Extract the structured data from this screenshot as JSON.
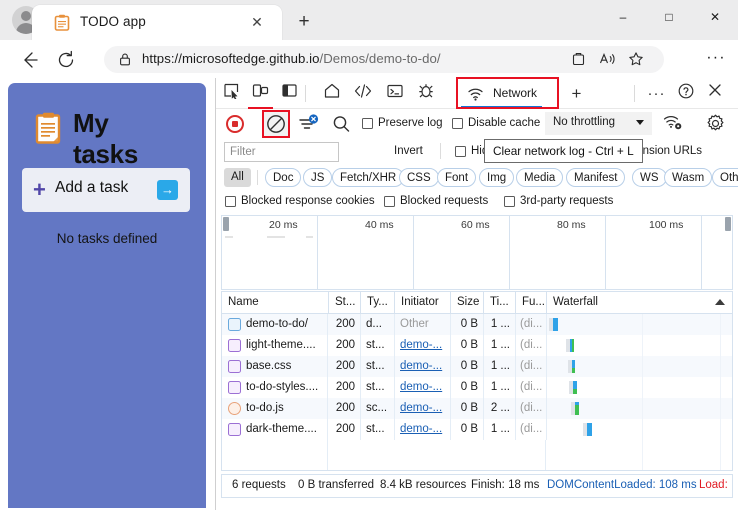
{
  "browser": {
    "tab": {
      "title": "TODO app",
      "favicon": "clipboard-icon",
      "close": "✕"
    },
    "new_tab": "+",
    "window_controls": {
      "minimize": "–",
      "maximize": "□",
      "close": "✕"
    },
    "nav": {
      "back": "←",
      "reload": "↻",
      "url_scheme": "https://",
      "url_host": "microsoftedge.github.io",
      "url_path": "/Demos/demo-to-do/",
      "lock": "lock-icon",
      "collections": "collections-icon",
      "read_aloud": "read-aloud-icon",
      "favorite": "star-icon",
      "more": "···"
    }
  },
  "app": {
    "title": "My tasks",
    "icon": "clipboard-icon",
    "add_task_label": "Add a task",
    "add_plus": "+",
    "add_arrow": "→",
    "empty_message": "No tasks defined"
  },
  "devtools": {
    "toolbar_icons": [
      {
        "name": "inspect-element-icon",
        "glyph": "inspect"
      },
      {
        "name": "device-emulation-icon",
        "glyph": "device"
      },
      {
        "name": "dock-side-icon",
        "glyph": "dock"
      }
    ],
    "panel_tabs": [
      {
        "name": "welcome-tab",
        "label": "",
        "icon": "home-icon"
      },
      {
        "name": "elements-tab",
        "label": "",
        "icon": "code-icon"
      },
      {
        "name": "console-tab",
        "label": "",
        "icon": "console-icon"
      },
      {
        "name": "sources-tab",
        "label": "",
        "icon": "debug-icon"
      },
      {
        "name": "network-tab",
        "label": "Network",
        "icon": "network-icon",
        "active": true
      }
    ],
    "more_tabs": "+",
    "more_tools": "···",
    "help": "?",
    "close": "✕",
    "controls": {
      "record": "record-icon",
      "clear": "clear-icon",
      "filter": "filter-icon",
      "search": "search-icon",
      "preserve_log": "Preserve log",
      "disable_cache": "Disable cache",
      "throttling": "No throttling",
      "network_conditions": "network-conditions-icon",
      "settings": "settings-gear-icon"
    },
    "tooltip": "Clear network log - Ctrl + L",
    "filter_row": {
      "filter_placeholder": "Filter",
      "invert": "Invert",
      "hide_data_urls": "Hide data URLs",
      "hide_extension_urls": "Hide extension URLs"
    },
    "type_filters": [
      "All",
      "Doc",
      "JS",
      "Fetch/XHR",
      "CSS",
      "Font",
      "Img",
      "Media",
      "Manifest",
      "WS",
      "Wasm",
      "Other"
    ],
    "blocked_row": [
      "Blocked response cookies",
      "Blocked requests",
      "3rd-party requests"
    ],
    "overview_ticks": [
      "20 ms",
      "40 ms",
      "60 ms",
      "80 ms",
      "100 ms"
    ],
    "table": {
      "columns": [
        "Name",
        "St...",
        "Ty...",
        "Initiator",
        "Size",
        "Ti...",
        "Fu...",
        "Waterfall"
      ],
      "rows": [
        {
          "icon": "document-icon",
          "name": "demo-to-do/",
          "status": "200",
          "type": "d...",
          "initiator": "Other",
          "initiator_link": false,
          "size": "0 B",
          "time": "1 ...",
          "full": "(di...",
          "wf_start": 2,
          "wf_queue": 4,
          "wf_width": 5
        },
        {
          "icon": "stylesheet-icon",
          "name": "light-theme....",
          "status": "200",
          "type": "st...",
          "initiator": "demo-...",
          "initiator_link": true,
          "size": "0 B",
          "time": "1 ...",
          "full": "(di...",
          "wf_start": 19,
          "wf_queue": 4,
          "wf_width": 4
        },
        {
          "icon": "stylesheet-icon",
          "name": "base.css",
          "status": "200",
          "type": "st...",
          "initiator": "demo-...",
          "initiator_link": true,
          "size": "0 B",
          "time": "1 ...",
          "full": "(di...",
          "wf_start": 21,
          "wf_queue": 4,
          "wf_width": 5
        },
        {
          "icon": "stylesheet-icon",
          "name": "to-do-styles....",
          "status": "200",
          "type": "st...",
          "initiator": "demo-...",
          "initiator_link": true,
          "size": "0 B",
          "time": "1 ...",
          "full": "(di...",
          "wf_start": 22,
          "wf_queue": 4,
          "wf_width": 5
        },
        {
          "icon": "script-icon",
          "name": "to-do.js",
          "status": "200",
          "type": "sc...",
          "initiator": "demo-...",
          "initiator_link": true,
          "size": "0 B",
          "time": "2 ...",
          "full": "(di...",
          "wf_start": 24,
          "wf_queue": 4,
          "wf_width": 5
        },
        {
          "icon": "stylesheet-icon",
          "name": "dark-theme....",
          "status": "200",
          "type": "st...",
          "initiator": "demo-...",
          "initiator_link": true,
          "size": "0 B",
          "time": "1 ...",
          "full": "(di...",
          "wf_start": 36,
          "wf_queue": 4,
          "wf_width": 5
        }
      ]
    },
    "status_bar": {
      "requests": "6 requests",
      "transferred": "0 B transferred",
      "resources": "8.4 kB resources",
      "finish": "Finish: 18 ms",
      "dcl": "DOMContentLoaded: 108 ms",
      "load": "Load:"
    }
  },
  "colors": {
    "accent_blue": "#1573d6",
    "highlight_red": "#e81123",
    "app_panel": "#6377c4",
    "link": "#1a5fb4",
    "load_red": "#e01b24",
    "waterfall_blue": "#2fa2e8",
    "waterfall_green": "#3fbf52"
  }
}
